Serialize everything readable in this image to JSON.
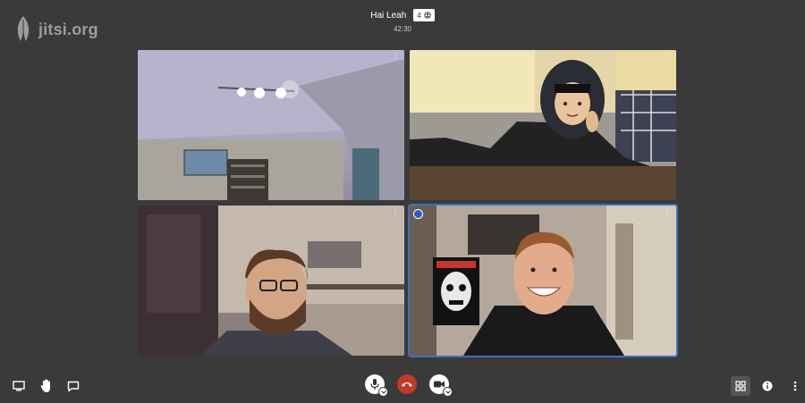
{
  "brand": {
    "logo_text": "jitsi.org"
  },
  "meeting": {
    "title": "Hai Leah",
    "participants": "4",
    "timer": "42:30"
  },
  "tiles": [
    {
      "id": "participant-1",
      "more_label": "⋮"
    },
    {
      "id": "participant-2",
      "more_label": "⋮"
    },
    {
      "id": "participant-3",
      "more_label": "⋮"
    },
    {
      "id": "participant-4",
      "more_label": "⋮",
      "active_speaker": true
    }
  ],
  "toolbar": {
    "left": [
      "screen-share-icon",
      "raise-hand-icon",
      "chat-icon"
    ],
    "center": [
      "microphone-icon",
      "hangup-icon",
      "camera-icon"
    ],
    "right": [
      "tile-view-icon",
      "info-icon",
      "more-icon"
    ]
  },
  "colors": {
    "background": "#3a3a3a",
    "hangup": "#c0392b",
    "active_border": "#3c6fbf"
  }
}
